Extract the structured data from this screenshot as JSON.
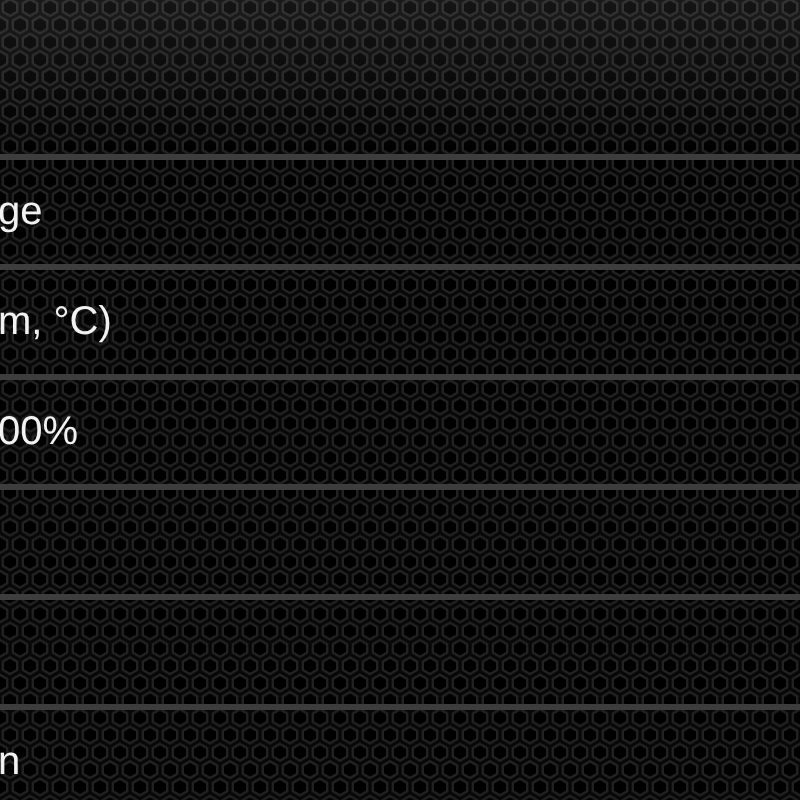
{
  "rows": [
    {
      "label": "ge"
    },
    {
      "label": "m, °C)"
    },
    {
      "label": "00%"
    },
    {},
    {},
    {
      "label": "n"
    }
  ]
}
